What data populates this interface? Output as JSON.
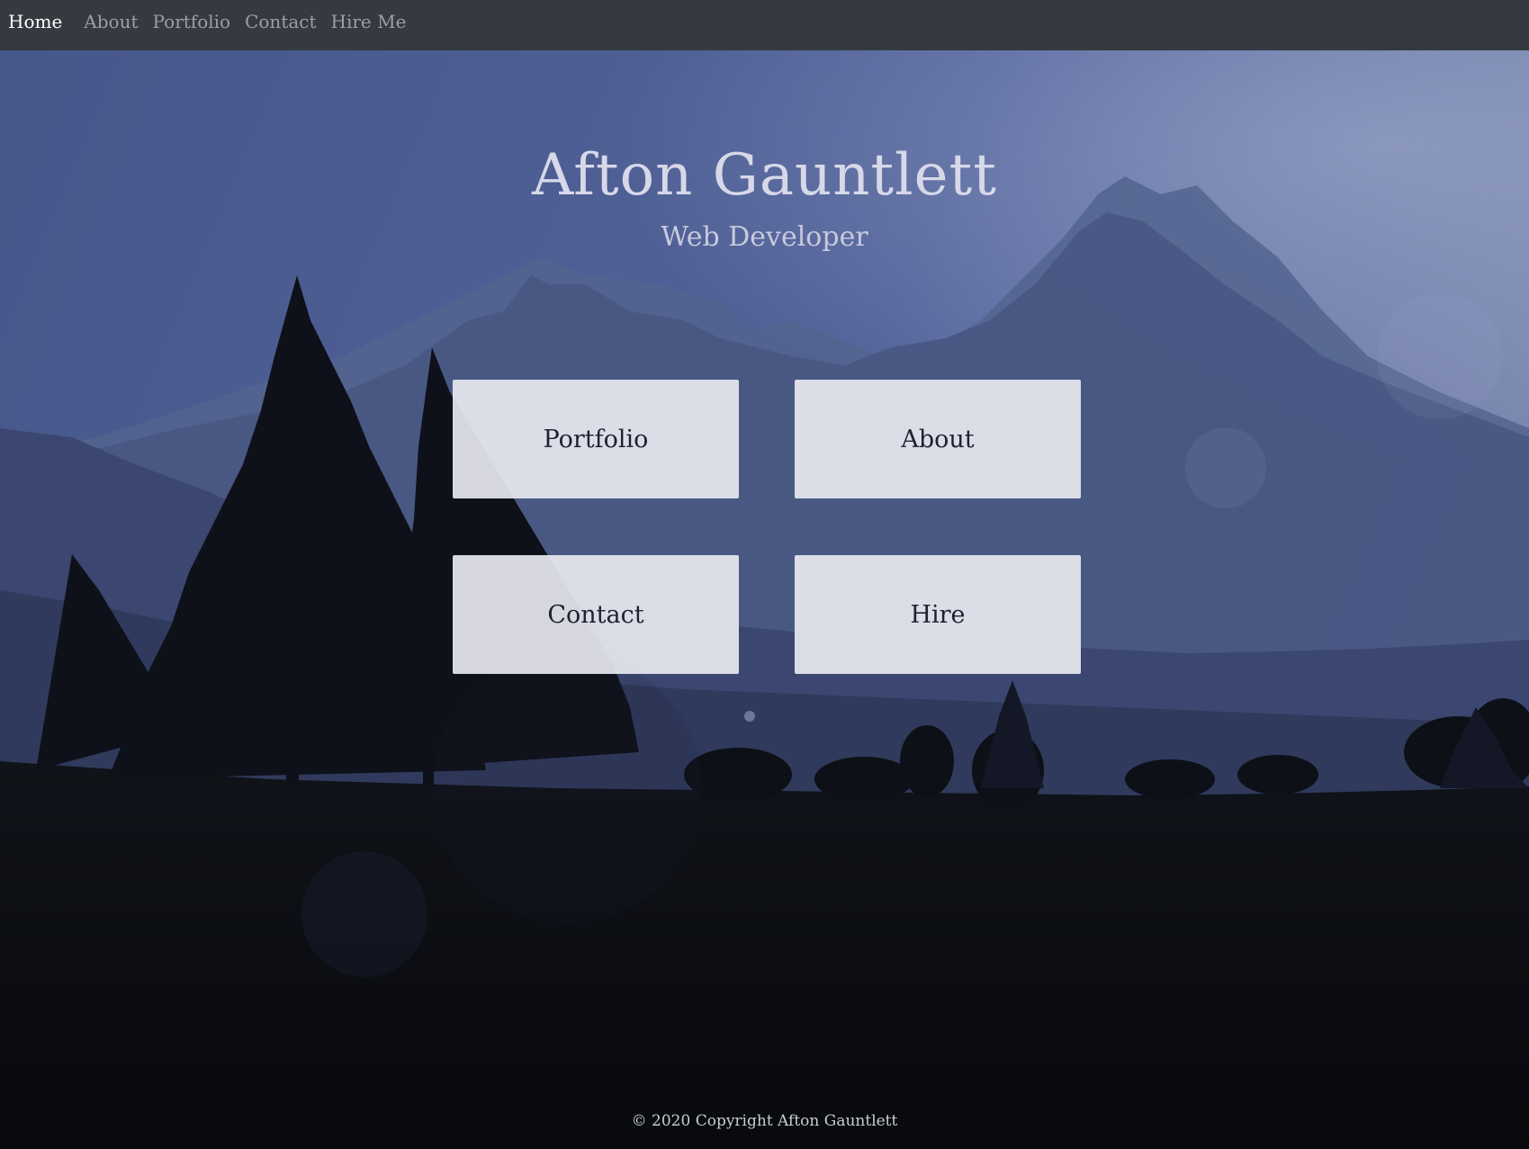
{
  "navbar": {
    "items": [
      {
        "label": "Home",
        "active": true
      },
      {
        "label": "About",
        "active": false
      },
      {
        "label": "Portfolio",
        "active": false
      },
      {
        "label": "Contact",
        "active": false
      },
      {
        "label": "Hire Me",
        "active": false
      }
    ]
  },
  "hero": {
    "title": "Afton Gauntlett",
    "subtitle": "Web Developer"
  },
  "tiles": {
    "portfolio": "Portfolio",
    "about": "About",
    "contact": "Contact",
    "hire": "Hire"
  },
  "footer": {
    "copyright": "© 2020 Copyright Afton Gauntlett"
  },
  "colors": {
    "navbar_bg": "#343a40",
    "sky": "#4c5d8a",
    "mountain_far": "#55668f",
    "mountain_near": "#3d4a70",
    "ground": "#0b0d12",
    "tile_bg": "#e8e9f0"
  }
}
